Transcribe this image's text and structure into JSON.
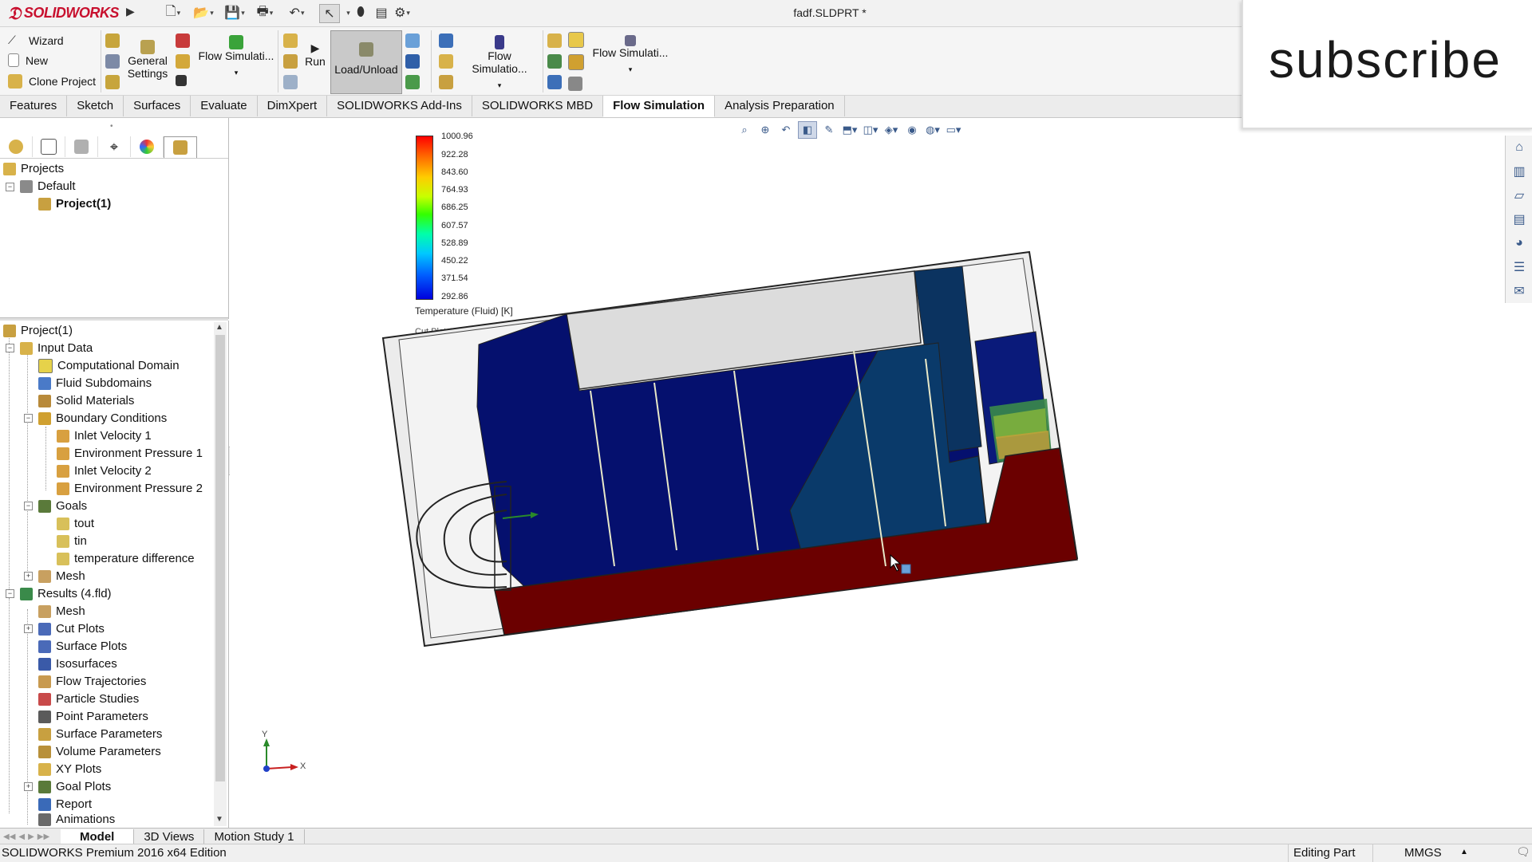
{
  "app": {
    "logo_text": "SOLIDWORKS",
    "document_title": "fadf.SLDPRT *"
  },
  "command_manager": {
    "wizard": "Wizard",
    "new": "New",
    "clone_project": "Clone Project",
    "general_settings_line1": "General",
    "general_settings_line2": "Settings",
    "flow_sim_1": "Flow Simulati...",
    "run": "Run",
    "load_unload": "Load/Unload",
    "flow_sim_2": "Flow Simulatio...",
    "flow_sim_3": "Flow Simulati..."
  },
  "tabs": [
    {
      "label": "Features"
    },
    {
      "label": "Sketch"
    },
    {
      "label": "Surfaces"
    },
    {
      "label": "Evaluate"
    },
    {
      "label": "DimXpert"
    },
    {
      "label": "SOLIDWORKS Add-Ins"
    },
    {
      "label": "SOLIDWORKS MBD"
    },
    {
      "label": "Flow Simulation"
    },
    {
      "label": "Analysis Preparation"
    }
  ],
  "project_tree": {
    "projects": "Projects",
    "default": "Default",
    "project": "Project(1)"
  },
  "analysis_tree": {
    "root": "Project(1)",
    "input_data": "Input Data",
    "computational_domain": "Computational Domain",
    "fluid_subdomains": "Fluid Subdomains",
    "solid_materials": "Solid Materials",
    "boundary_conditions": "Boundary Conditions",
    "inlet_velocity_1": "Inlet Velocity 1",
    "env_pressure_1": "Environment Pressure 1",
    "inlet_velocity_2": "Inlet Velocity 2",
    "env_pressure_2": "Environment Pressure 2",
    "goals": "Goals",
    "tout": "tout",
    "tin": "tin",
    "temp_diff": "temperature difference",
    "mesh_input": "Mesh",
    "results": "Results (4.fld)",
    "mesh_results": "Mesh",
    "cut_plots": "Cut Plots",
    "surface_plots": "Surface Plots",
    "isosurfaces": "Isosurfaces",
    "flow_trajectories": "Flow Trajectories",
    "particle_studies": "Particle Studies",
    "point_parameters": "Point Parameters",
    "surface_parameters": "Surface Parameters",
    "volume_parameters": "Volume Parameters",
    "xy_plots": "XY Plots",
    "goal_plots": "Goal Plots",
    "report": "Report",
    "animations": "Animations"
  },
  "legend": {
    "values": [
      "1000.96",
      "922.28",
      "843.60",
      "764.93",
      "686.25",
      "607.57",
      "528.89",
      "450.22",
      "371.54",
      "292.86"
    ],
    "title": "Temperature (Fluid) [K]",
    "cut_plot_label": "Cut Plot 1: contours"
  },
  "triad": {
    "x": "X",
    "y": "Y"
  },
  "overlay": {
    "subscribe": "subscribe"
  },
  "bottom_tabs": [
    {
      "label": "Model"
    },
    {
      "label": "3D Views"
    },
    {
      "label": "Motion Study 1"
    }
  ],
  "status": {
    "edition": "SOLIDWORKS Premium 2016 x64 Edition",
    "mode": "Editing Part",
    "units": "MMGS",
    "units_arrow": "▲"
  },
  "colors": {
    "hot": "#6b0000",
    "cold": "#05106e",
    "mid": "#0a3a6a",
    "brand": "#c8102e"
  }
}
